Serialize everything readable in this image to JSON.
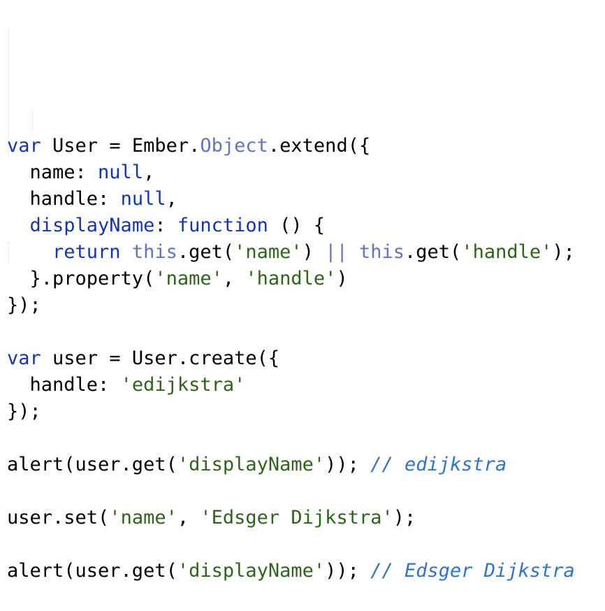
{
  "code": {
    "lines": [
      {
        "tokens": [
          {
            "text": "var",
            "type": "kw"
          },
          {
            "text": " User = Ember.",
            "type": "ident"
          },
          {
            "text": "Object",
            "type": "builtin"
          },
          {
            "text": ".extend({",
            "type": "ident"
          }
        ]
      },
      {
        "tokens": [
          {
            "text": "  name: ",
            "type": "ident"
          },
          {
            "text": "null",
            "type": "kw"
          },
          {
            "text": ",",
            "type": "punct"
          }
        ]
      },
      {
        "tokens": [
          {
            "text": "  handle: ",
            "type": "ident"
          },
          {
            "text": "null",
            "type": "kw"
          },
          {
            "text": ",",
            "type": "punct"
          }
        ]
      },
      {
        "tokens": [
          {
            "text": "  ",
            "type": "ident"
          },
          {
            "text": "displayName",
            "type": "fnname"
          },
          {
            "text": ": ",
            "type": "ident"
          },
          {
            "text": "function",
            "type": "kw"
          },
          {
            "text": " () {",
            "type": "ident"
          }
        ]
      },
      {
        "tokens": [
          {
            "text": "    ",
            "type": "ident"
          },
          {
            "text": "return",
            "type": "kw"
          },
          {
            "text": " ",
            "type": "ident"
          },
          {
            "text": "this",
            "type": "builtin"
          },
          {
            "text": ".get(",
            "type": "ident"
          },
          {
            "text": "'name'",
            "type": "str"
          },
          {
            "text": ") ",
            "type": "ident"
          },
          {
            "text": "||",
            "type": "builtin"
          },
          {
            "text": " ",
            "type": "ident"
          },
          {
            "text": "this",
            "type": "builtin"
          },
          {
            "text": ".get(",
            "type": "ident"
          },
          {
            "text": "'handle'",
            "type": "str"
          },
          {
            "text": ");",
            "type": "ident"
          }
        ]
      },
      {
        "tokens": [
          {
            "text": "  }.property(",
            "type": "ident"
          },
          {
            "text": "'name'",
            "type": "str"
          },
          {
            "text": ", ",
            "type": "ident"
          },
          {
            "text": "'handle'",
            "type": "str"
          },
          {
            "text": ")",
            "type": "ident"
          }
        ]
      },
      {
        "tokens": [
          {
            "text": "});",
            "type": "ident"
          }
        ]
      },
      {
        "tokens": []
      },
      {
        "tokens": [
          {
            "text": "var",
            "type": "kw"
          },
          {
            "text": " user = User.create({",
            "type": "ident"
          }
        ]
      },
      {
        "tokens": [
          {
            "text": "  handle: ",
            "type": "ident"
          },
          {
            "text": "'edijkstra'",
            "type": "str"
          }
        ]
      },
      {
        "tokens": [
          {
            "text": "});",
            "type": "ident"
          }
        ]
      },
      {
        "tokens": []
      },
      {
        "tokens": [
          {
            "text": "alert(user.get(",
            "type": "ident"
          },
          {
            "text": "'displayName'",
            "type": "str"
          },
          {
            "text": ")); ",
            "type": "ident"
          },
          {
            "text": "// edijkstra",
            "type": "comment"
          }
        ]
      },
      {
        "tokens": []
      },
      {
        "tokens": [
          {
            "text": "user.set(",
            "type": "ident"
          },
          {
            "text": "'name'",
            "type": "str"
          },
          {
            "text": ", ",
            "type": "ident"
          },
          {
            "text": "'Edsger Dijkstra'",
            "type": "str"
          },
          {
            "text": ");",
            "type": "ident"
          }
        ]
      },
      {
        "tokens": []
      },
      {
        "tokens": [
          {
            "text": "alert(user.get(",
            "type": "ident"
          },
          {
            "text": "'displayName'",
            "type": "str"
          },
          {
            "text": ")); ",
            "type": "ident"
          },
          {
            "text": "// Edsger Dijkstra",
            "type": "comment"
          }
        ]
      }
    ]
  },
  "colors": {
    "keyword": "#1434b8",
    "builtin": "#6172c7",
    "string": "#2d6419",
    "comment": "#2d73d1",
    "text": "#000000",
    "background": "#ffffff"
  }
}
